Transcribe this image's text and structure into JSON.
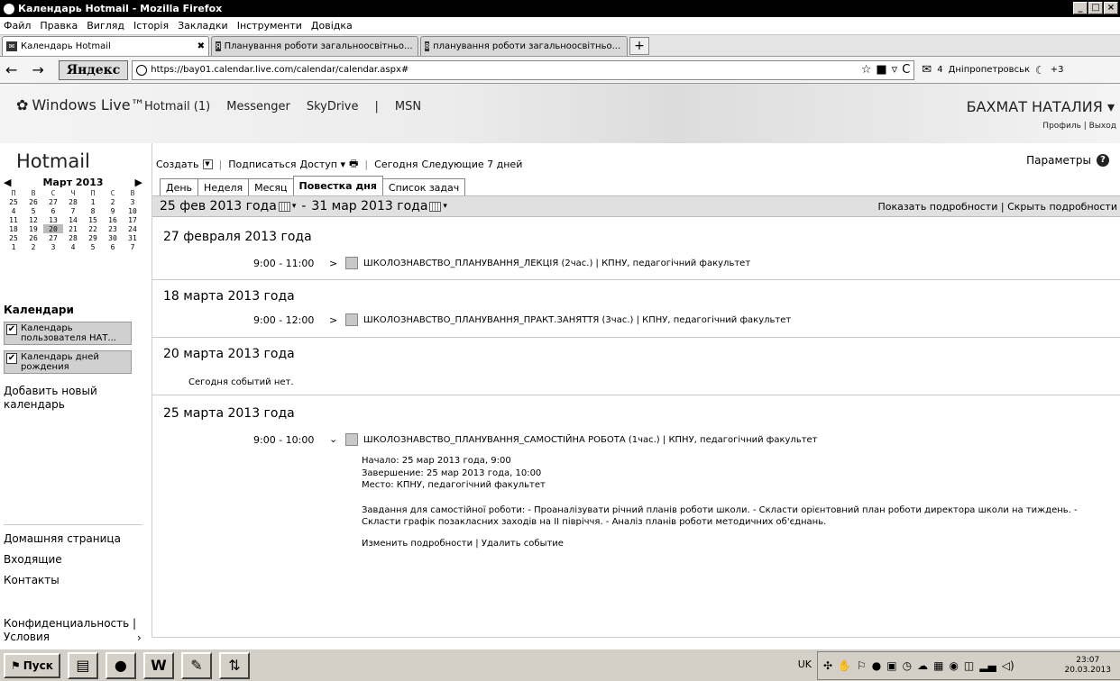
{
  "window": {
    "title": "Календарь Hotmail - Mozilla Firefox"
  },
  "menu": [
    "Файл",
    "Правка",
    "Вигляд",
    "Історія",
    "Закладки",
    "Інструменти",
    "Довідка"
  ],
  "browser_tabs": [
    {
      "label": "Календарь Hotmail",
      "icon": "mail-icon"
    },
    {
      "label": "Планування роботи загальноосвітньо...",
      "icon": "yandex-icon"
    },
    {
      "label": "планування роботи загальноосвітньо...",
      "icon": "search-icon"
    }
  ],
  "nav": {
    "yandex": "Яндекс",
    "url": "https://bay01.calendar.live.com/calendar/calendar.aspx#",
    "mail_count": "4",
    "city": "Дніпропетровськ",
    "temp": "+3"
  },
  "wl": {
    "logo": "Windows Live™",
    "links": [
      "Hotmail (1)",
      "Messenger",
      "SkyDrive",
      "|",
      "MSN"
    ],
    "user": "БАХМАТ НАТАЛИЯ",
    "profile": "Профиль",
    "logout": "Выход"
  },
  "sidebar": {
    "title": "Hotmail",
    "month": "Март 2013",
    "dow": [
      "П",
      "В",
      "С",
      "Ч",
      "П",
      "С",
      "В"
    ],
    "weeks": [
      [
        "25",
        "26",
        "27",
        "28",
        "1",
        "2",
        "3"
      ],
      [
        "4",
        "5",
        "6",
        "7",
        "8",
        "9",
        "10"
      ],
      [
        "11",
        "12",
        "13",
        "14",
        "15",
        "16",
        "17"
      ],
      [
        "18",
        "19",
        "20",
        "21",
        "22",
        "23",
        "24"
      ],
      [
        "25",
        "26",
        "27",
        "28",
        "29",
        "30",
        "31"
      ],
      [
        "1",
        "2",
        "3",
        "4",
        "5",
        "6",
        "7"
      ]
    ],
    "calendars_title": "Календари",
    "calendars": [
      "Календарь пользователя НАТ...",
      "Календарь дней рождения"
    ],
    "add_calendar": "Добавить новый календарь",
    "links": [
      "Домашняя страница",
      "Входящие",
      "Контакты"
    ],
    "privacy": "Конфиденциальность | Условия"
  },
  "toolbar": {
    "create": "Создать",
    "subscribe": "Подписаться",
    "access": "Доступ",
    "today": "Сегодня",
    "next7": "Следующие 7 дней",
    "params": "Параметры"
  },
  "view_tabs": [
    "День",
    "Неделя",
    "Месяц",
    "Повестка дня",
    "Список задач"
  ],
  "range": {
    "start": "25 фев 2013 года",
    "dash": "-",
    "end": "31 мар 2013 года",
    "show": "Показать подробности",
    "hide": "Скрыть подробности"
  },
  "days": [
    {
      "title": "27 февраля 2013 года",
      "time": "9:00 - 11:00",
      "event": "ШКОЛОЗНАВСТВО_ПЛАНУВАННЯ_ЛЕКЦІЯ (2час.) | КПНУ, педагогічний факультет"
    },
    {
      "title": "18 марта 2013 года",
      "time": "9:00 - 12:00",
      "event": "ШКОЛОЗНАВСТВО_ПЛАНУВАННЯ_ПРАКТ.ЗАНЯТТЯ (3час.) | КПНУ, педагогічний факультет"
    },
    {
      "title": "20 марта 2013 года",
      "no_events": "Сегодня событий нет."
    },
    {
      "title": "25 марта 2013 года",
      "time": "9:00 - 10:00",
      "event": "ШКОЛОЗНАВСТВО_ПЛАНУВАННЯ_САМОСТІЙНА РОБОТА (1час.) | КПНУ, педагогічний факультет",
      "start": "Начало: 25 мар 2013 года, 9:00",
      "end": "Завершение: 25 мар 2013 года, 10:00",
      "place": "Место: КПНУ, педагогічний факультет",
      "desc1": "Завдання для самостійної роботи: - Проаналізувати річний планів роботи школи. - Скласти орієнтовний план роботи директора школи на тиждень. -",
      "desc2": "Скласти графік позакласних заходів на ІІ півріччя. - Аналіз планів роботи методичних об'єднань.",
      "edit": "Изменить подробности",
      "delete": "Удалить событие"
    }
  ],
  "taskbar": {
    "start": "Пуск",
    "lang": "UK",
    "time": "23:07",
    "date": "20.03.2013"
  }
}
